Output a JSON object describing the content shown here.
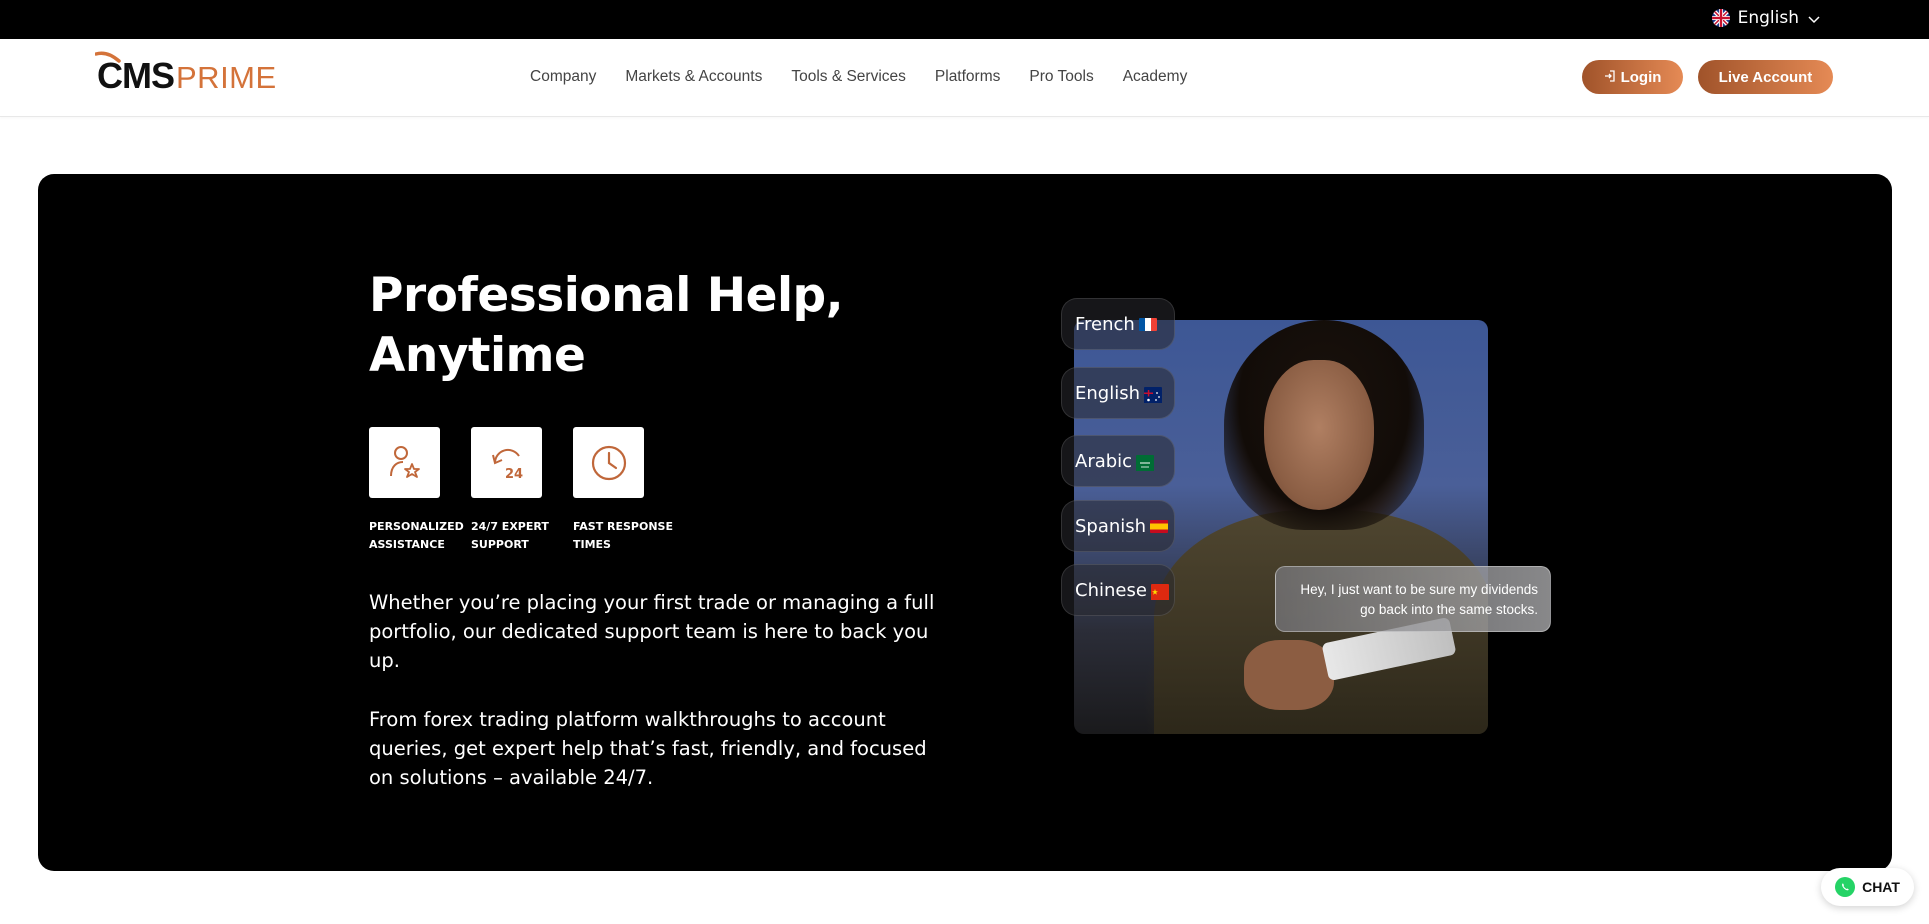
{
  "topbar": {
    "language": "English"
  },
  "header": {
    "logo_main": "CMS",
    "logo_sub": "PRIME",
    "nav": [
      "Company",
      "Markets & Accounts",
      "Tools & Services",
      "Platforms",
      "Pro Tools",
      "Academy"
    ],
    "login_label": "Login",
    "live_label": "Live Account",
    "accent_color": "#d4733a"
  },
  "hero": {
    "title_line1": "Professional Help,",
    "title_line2": "Anytime",
    "features": [
      {
        "icon": "user-star-icon",
        "line1": "PERSONALIZED",
        "line2": "ASSISTANCE"
      },
      {
        "icon": "24-hours-icon",
        "line1": "24/7 EXPERT",
        "line2": "SUPPORT"
      },
      {
        "icon": "clock-icon",
        "line1": "FAST RESPONSE",
        "line2": "TIMES"
      }
    ],
    "paragraph1": "Whether you’re placing your first trade or managing a full portfolio, our dedicated support team is here to back you up.",
    "paragraph2": "From forex trading platform walkthroughs to account queries, get expert help that’s fast, friendly, and focused on solutions – available 24/7.",
    "languages": [
      {
        "label": "French",
        "flag": "flag-france-icon"
      },
      {
        "label": "English",
        "flag": "flag-australia-icon"
      },
      {
        "label": "Arabic",
        "flag": "flag-saudi-arabia-icon"
      },
      {
        "label": "Spanish",
        "flag": "flag-spain-icon"
      },
      {
        "label": "Chinese",
        "flag": "flag-china-icon"
      }
    ],
    "chat_bubble": "Hey, I just want to be sure my dividends go back into the same stocks."
  },
  "chat_widget": {
    "label": "CHAT"
  }
}
